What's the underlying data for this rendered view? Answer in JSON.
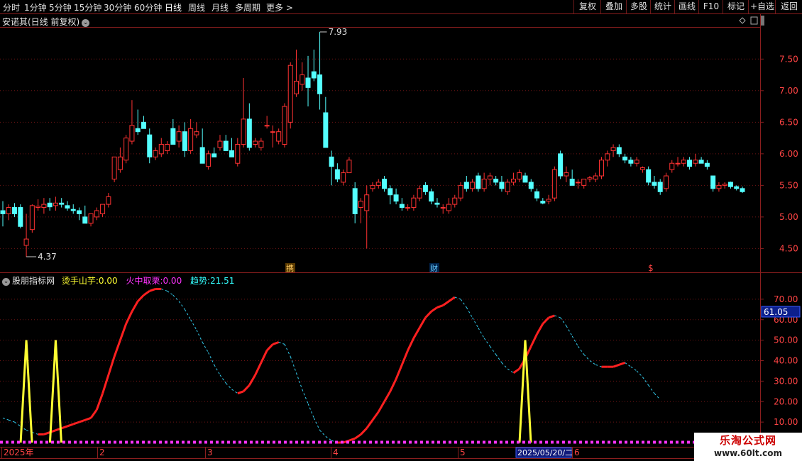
{
  "toolbar": {
    "periods": [
      "分时",
      "1分钟",
      "5分钟",
      "15分钟",
      "30分钟",
      "60分钟",
      "日线",
      "周线",
      "月线",
      "多周期",
      "更多 >"
    ],
    "active_period": "日线",
    "right_buttons": [
      "复权",
      "叠加",
      "多股",
      "统计",
      "画线",
      "F10",
      "标记",
      "+自选",
      "返回"
    ]
  },
  "main_chart": {
    "title": "安诺其(日线 前复权)",
    "high_label": "7.93",
    "low_label": "4.37",
    "price_ticks": [
      "7.50",
      "7.00",
      "6.50",
      "6.00",
      "5.50",
      "5.00",
      "4.50"
    ],
    "markers": [
      "携",
      "财",
      "$"
    ]
  },
  "indicator": {
    "name": "股朋指标网",
    "series": [
      {
        "label": "烫手山芋:",
        "value": "0.00",
        "color": "#ffff33"
      },
      {
        "label": "火中取栗:",
        "value": "0.00",
        "color": "#ff33ff"
      },
      {
        "label": "趋势:",
        "value": "21.51",
        "color": "#33ffff"
      }
    ],
    "ticks": [
      "70.00",
      "60.00",
      "50.00",
      "40.00",
      "30.00",
      "20.00",
      "10.00"
    ],
    "current_value_tag": "61.05"
  },
  "time_axis": {
    "labels": [
      "2025年",
      "2",
      "3",
      "4",
      "5",
      "2025/05/20/二",
      "6"
    ]
  },
  "watermark": {
    "title": "乐淘公式网",
    "url": "www.60lt.com"
  },
  "colors": {
    "up": "#ff3232",
    "down": "#54ffff",
    "axis": "#8a1e1e",
    "grid": "#6e1414"
  },
  "chart_data": {
    "type": "candlestick",
    "ylim": [
      4.3,
      8.0
    ],
    "candles": [
      [
        5.1,
        5.25,
        4.85,
        5.05
      ],
      [
        5.05,
        5.2,
        4.95,
        5.15
      ],
      [
        5.15,
        5.22,
        5.0,
        5.05
      ],
      [
        5.15,
        5.2,
        4.82,
        4.85
      ],
      [
        4.55,
        5.05,
        4.37,
        4.65
      ],
      [
        4.8,
        5.2,
        4.75,
        5.18
      ],
      [
        5.15,
        5.28,
        5.1,
        5.17
      ],
      [
        5.15,
        5.3,
        5.05,
        5.2
      ],
      [
        5.22,
        5.3,
        5.1,
        5.16
      ],
      [
        5.18,
        5.32,
        5.1,
        5.22
      ],
      [
        5.22,
        5.3,
        5.15,
        5.2
      ],
      [
        5.18,
        5.25,
        5.1,
        5.14
      ],
      [
        5.12,
        5.2,
        5.05,
        5.1
      ],
      [
        5.1,
        5.15,
        4.95,
        5.05
      ],
      [
        5.0,
        5.18,
        4.95,
        4.9
      ],
      [
        4.9,
        5.05,
        4.85,
        5.05
      ],
      [
        5.0,
        5.15,
        4.95,
        5.1
      ],
      [
        5.05,
        5.2,
        5.0,
        5.2
      ],
      [
        5.2,
        5.38,
        5.15,
        5.32
      ],
      [
        5.6,
        5.95,
        5.55,
        5.95
      ],
      [
        5.75,
        6.1,
        5.7,
        5.95
      ],
      [
        5.9,
        6.3,
        5.85,
        6.25
      ],
      [
        6.2,
        6.85,
        6.15,
        6.45
      ],
      [
        6.4,
        6.7,
        6.3,
        6.35
      ],
      [
        6.5,
        6.6,
        6.4,
        6.4
      ],
      [
        6.3,
        6.4,
        5.85,
        5.95
      ],
      [
        5.95,
        6.1,
        5.9,
        6.05
      ],
      [
        6.0,
        6.25,
        5.95,
        6.15
      ],
      [
        6.05,
        6.2,
        6.0,
        6.15
      ],
      [
        6.4,
        6.55,
        6.2,
        6.15
      ],
      [
        6.2,
        6.45,
        6.1,
        6.35
      ],
      [
        6.35,
        6.5,
        5.95,
        6.05
      ],
      [
        6.05,
        6.55,
        6.0,
        6.4
      ],
      [
        6.3,
        6.5,
        6.25,
        6.35
      ],
      [
        6.1,
        6.4,
        5.9,
        5.85
      ],
      [
        5.8,
        6.05,
        5.75,
        6.0
      ],
      [
        6.0,
        6.1,
        5.95,
        5.95
      ],
      [
        6.1,
        6.3,
        6.05,
        6.2
      ],
      [
        6.2,
        6.3,
        6.05,
        6.05
      ],
      [
        6.05,
        6.25,
        6.0,
        5.95
      ],
      [
        5.85,
        6.25,
        5.8,
        6.15
      ],
      [
        6.15,
        7.2,
        6.1,
        6.55
      ],
      [
        6.55,
        6.8,
        6.05,
        6.1
      ],
      [
        6.15,
        6.25,
        6.1,
        6.2
      ],
      [
        6.1,
        6.25,
        6.05,
        6.2
      ],
      [
        6.45,
        6.6,
        6.4,
        6.45
      ],
      [
        6.35,
        6.45,
        6.1,
        6.35
      ],
      [
        6.2,
        6.4,
        6.15,
        6.35
      ],
      [
        6.15,
        6.8,
        6.1,
        6.75
      ],
      [
        6.5,
        7.45,
        6.4,
        7.4
      ],
      [
        6.95,
        7.65,
        6.9,
        7.15
      ],
      [
        7.1,
        7.45,
        7.0,
        7.25
      ],
      [
        7.2,
        7.55,
        6.75,
        7.05
      ],
      [
        7.3,
        7.65,
        7.15,
        7.2
      ],
      [
        7.25,
        7.93,
        6.7,
        6.95
      ],
      [
        6.65,
        6.9,
        6.1,
        6.1
      ],
      [
        5.95,
        6.05,
        5.5,
        5.8
      ],
      [
        5.75,
        5.85,
        5.55,
        5.6
      ],
      [
        5.55,
        5.75,
        5.5,
        5.7
      ],
      [
        5.7,
        5.95,
        5.7,
        5.9
      ],
      [
        5.45,
        5.55,
        4.9,
        5.05
      ],
      [
        5.15,
        5.3,
        4.9,
        5.25
      ],
      [
        5.1,
        5.5,
        4.5,
        5.35
      ],
      [
        5.45,
        5.55,
        5.4,
        5.5
      ],
      [
        5.5,
        5.6,
        5.45,
        5.55
      ],
      [
        5.6,
        5.65,
        5.4,
        5.45
      ],
      [
        5.45,
        5.5,
        5.2,
        5.35
      ],
      [
        5.35,
        5.45,
        5.2,
        5.25
      ],
      [
        5.2,
        5.3,
        5.1,
        5.15
      ],
      [
        5.15,
        5.2,
        5.1,
        5.15
      ],
      [
        5.15,
        5.35,
        5.1,
        5.3
      ],
      [
        5.3,
        5.5,
        5.25,
        5.45
      ],
      [
        5.5,
        5.55,
        5.35,
        5.4
      ],
      [
        5.4,
        5.45,
        5.2,
        5.25
      ],
      [
        5.22,
        5.3,
        5.15,
        5.2
      ],
      [
        5.15,
        5.2,
        5.05,
        5.15
      ],
      [
        5.1,
        5.3,
        5.05,
        5.2
      ],
      [
        5.2,
        5.35,
        5.15,
        5.3
      ],
      [
        5.3,
        5.55,
        5.25,
        5.5
      ],
      [
        5.55,
        5.65,
        5.4,
        5.45
      ],
      [
        5.45,
        5.6,
        5.4,
        5.55
      ],
      [
        5.65,
        5.7,
        5.4,
        5.45
      ],
      [
        5.45,
        5.7,
        5.4,
        5.6
      ],
      [
        5.6,
        5.7,
        5.5,
        5.65
      ],
      [
        5.6,
        5.65,
        5.5,
        5.55
      ],
      [
        5.55,
        5.65,
        5.4,
        5.45
      ],
      [
        5.4,
        5.6,
        5.35,
        5.55
      ],
      [
        5.55,
        5.7,
        5.5,
        5.6
      ],
      [
        5.6,
        5.75,
        5.55,
        5.7
      ],
      [
        5.65,
        5.7,
        5.55,
        5.55
      ],
      [
        5.55,
        5.6,
        5.4,
        5.45
      ],
      [
        5.4,
        5.45,
        5.25,
        5.3
      ],
      [
        5.25,
        5.3,
        5.2,
        5.22
      ],
      [
        5.25,
        5.35,
        5.2,
        5.28
      ],
      [
        5.3,
        5.8,
        5.25,
        5.75
      ],
      [
        6.0,
        6.05,
        5.6,
        5.65
      ],
      [
        5.65,
        5.8,
        5.55,
        5.7
      ],
      [
        5.6,
        5.75,
        5.55,
        5.5
      ],
      [
        5.55,
        5.6,
        5.45,
        5.55
      ],
      [
        5.5,
        5.6,
        5.45,
        5.6
      ],
      [
        5.6,
        5.65,
        5.55,
        5.62
      ],
      [
        5.6,
        5.7,
        5.55,
        5.65
      ],
      [
        5.65,
        5.95,
        5.6,
        5.9
      ],
      [
        5.9,
        6.05,
        5.8,
        6.0
      ],
      [
        6.05,
        6.15,
        5.95,
        6.1
      ],
      [
        6.1,
        6.15,
        5.95,
        6.0
      ],
      [
        5.95,
        6.0,
        5.85,
        5.9
      ],
      [
        5.9,
        5.95,
        5.8,
        5.85
      ],
      [
        5.85,
        5.95,
        5.8,
        5.9
      ],
      [
        5.75,
        5.8,
        5.7,
        5.78
      ],
      [
        5.75,
        5.8,
        5.5,
        5.55
      ],
      [
        5.55,
        5.65,
        5.45,
        5.5
      ],
      [
        5.55,
        5.6,
        5.35,
        5.4
      ],
      [
        5.45,
        5.7,
        5.4,
        5.65
      ],
      [
        5.75,
        5.9,
        5.7,
        5.85
      ],
      [
        5.85,
        5.95,
        5.8,
        5.85
      ],
      [
        5.85,
        5.95,
        5.8,
        5.9
      ],
      [
        5.9,
        5.95,
        5.75,
        5.8
      ],
      [
        5.85,
        6.0,
        5.8,
        5.9
      ],
      [
        5.9,
        5.95,
        5.85,
        5.85
      ],
      [
        5.85,
        5.9,
        5.75,
        5.8
      ],
      [
        5.65,
        5.65,
        5.4,
        5.45
      ],
      [
        5.45,
        5.55,
        5.4,
        5.5
      ],
      [
        5.5,
        5.55,
        5.45,
        5.52
      ],
      [
        5.55,
        5.56,
        5.45,
        5.48
      ],
      [
        5.48,
        5.5,
        5.42,
        5.45
      ],
      [
        5.45,
        5.48,
        5.38,
        5.4
      ]
    ],
    "indicator": {
      "ylim": [
        0,
        80
      ],
      "trend": [
        12,
        11,
        10,
        8,
        6,
        5,
        4,
        4,
        5,
        6,
        7,
        8,
        9,
        10,
        11,
        12,
        16,
        24,
        33,
        42,
        50,
        58,
        64,
        69,
        72,
        74,
        75,
        75,
        74,
        72,
        69,
        65,
        60,
        55,
        49,
        44,
        38,
        33,
        29,
        26,
        24,
        25,
        28,
        33,
        39,
        45,
        48,
        49,
        48,
        42,
        34,
        26,
        19,
        12,
        6,
        3,
        1,
        0,
        0,
        1,
        2,
        4,
        7,
        11,
        15,
        20,
        25,
        31,
        38,
        45,
        51,
        56,
        61,
        64,
        66,
        67,
        69,
        71,
        70,
        66,
        61,
        56,
        51,
        47,
        43,
        39,
        36,
        34,
        36,
        41,
        47,
        53,
        58,
        61,
        62,
        61,
        57,
        52,
        47,
        43,
        40,
        38,
        37,
        37,
        37,
        38,
        39,
        37,
        35,
        32,
        28,
        24,
        21
      ],
      "yellow_peaks": [
        {
          "idx": 4,
          "value": 50
        },
        {
          "idx": 9,
          "value": 50
        },
        {
          "idx": 89,
          "value": 50
        }
      ]
    }
  }
}
